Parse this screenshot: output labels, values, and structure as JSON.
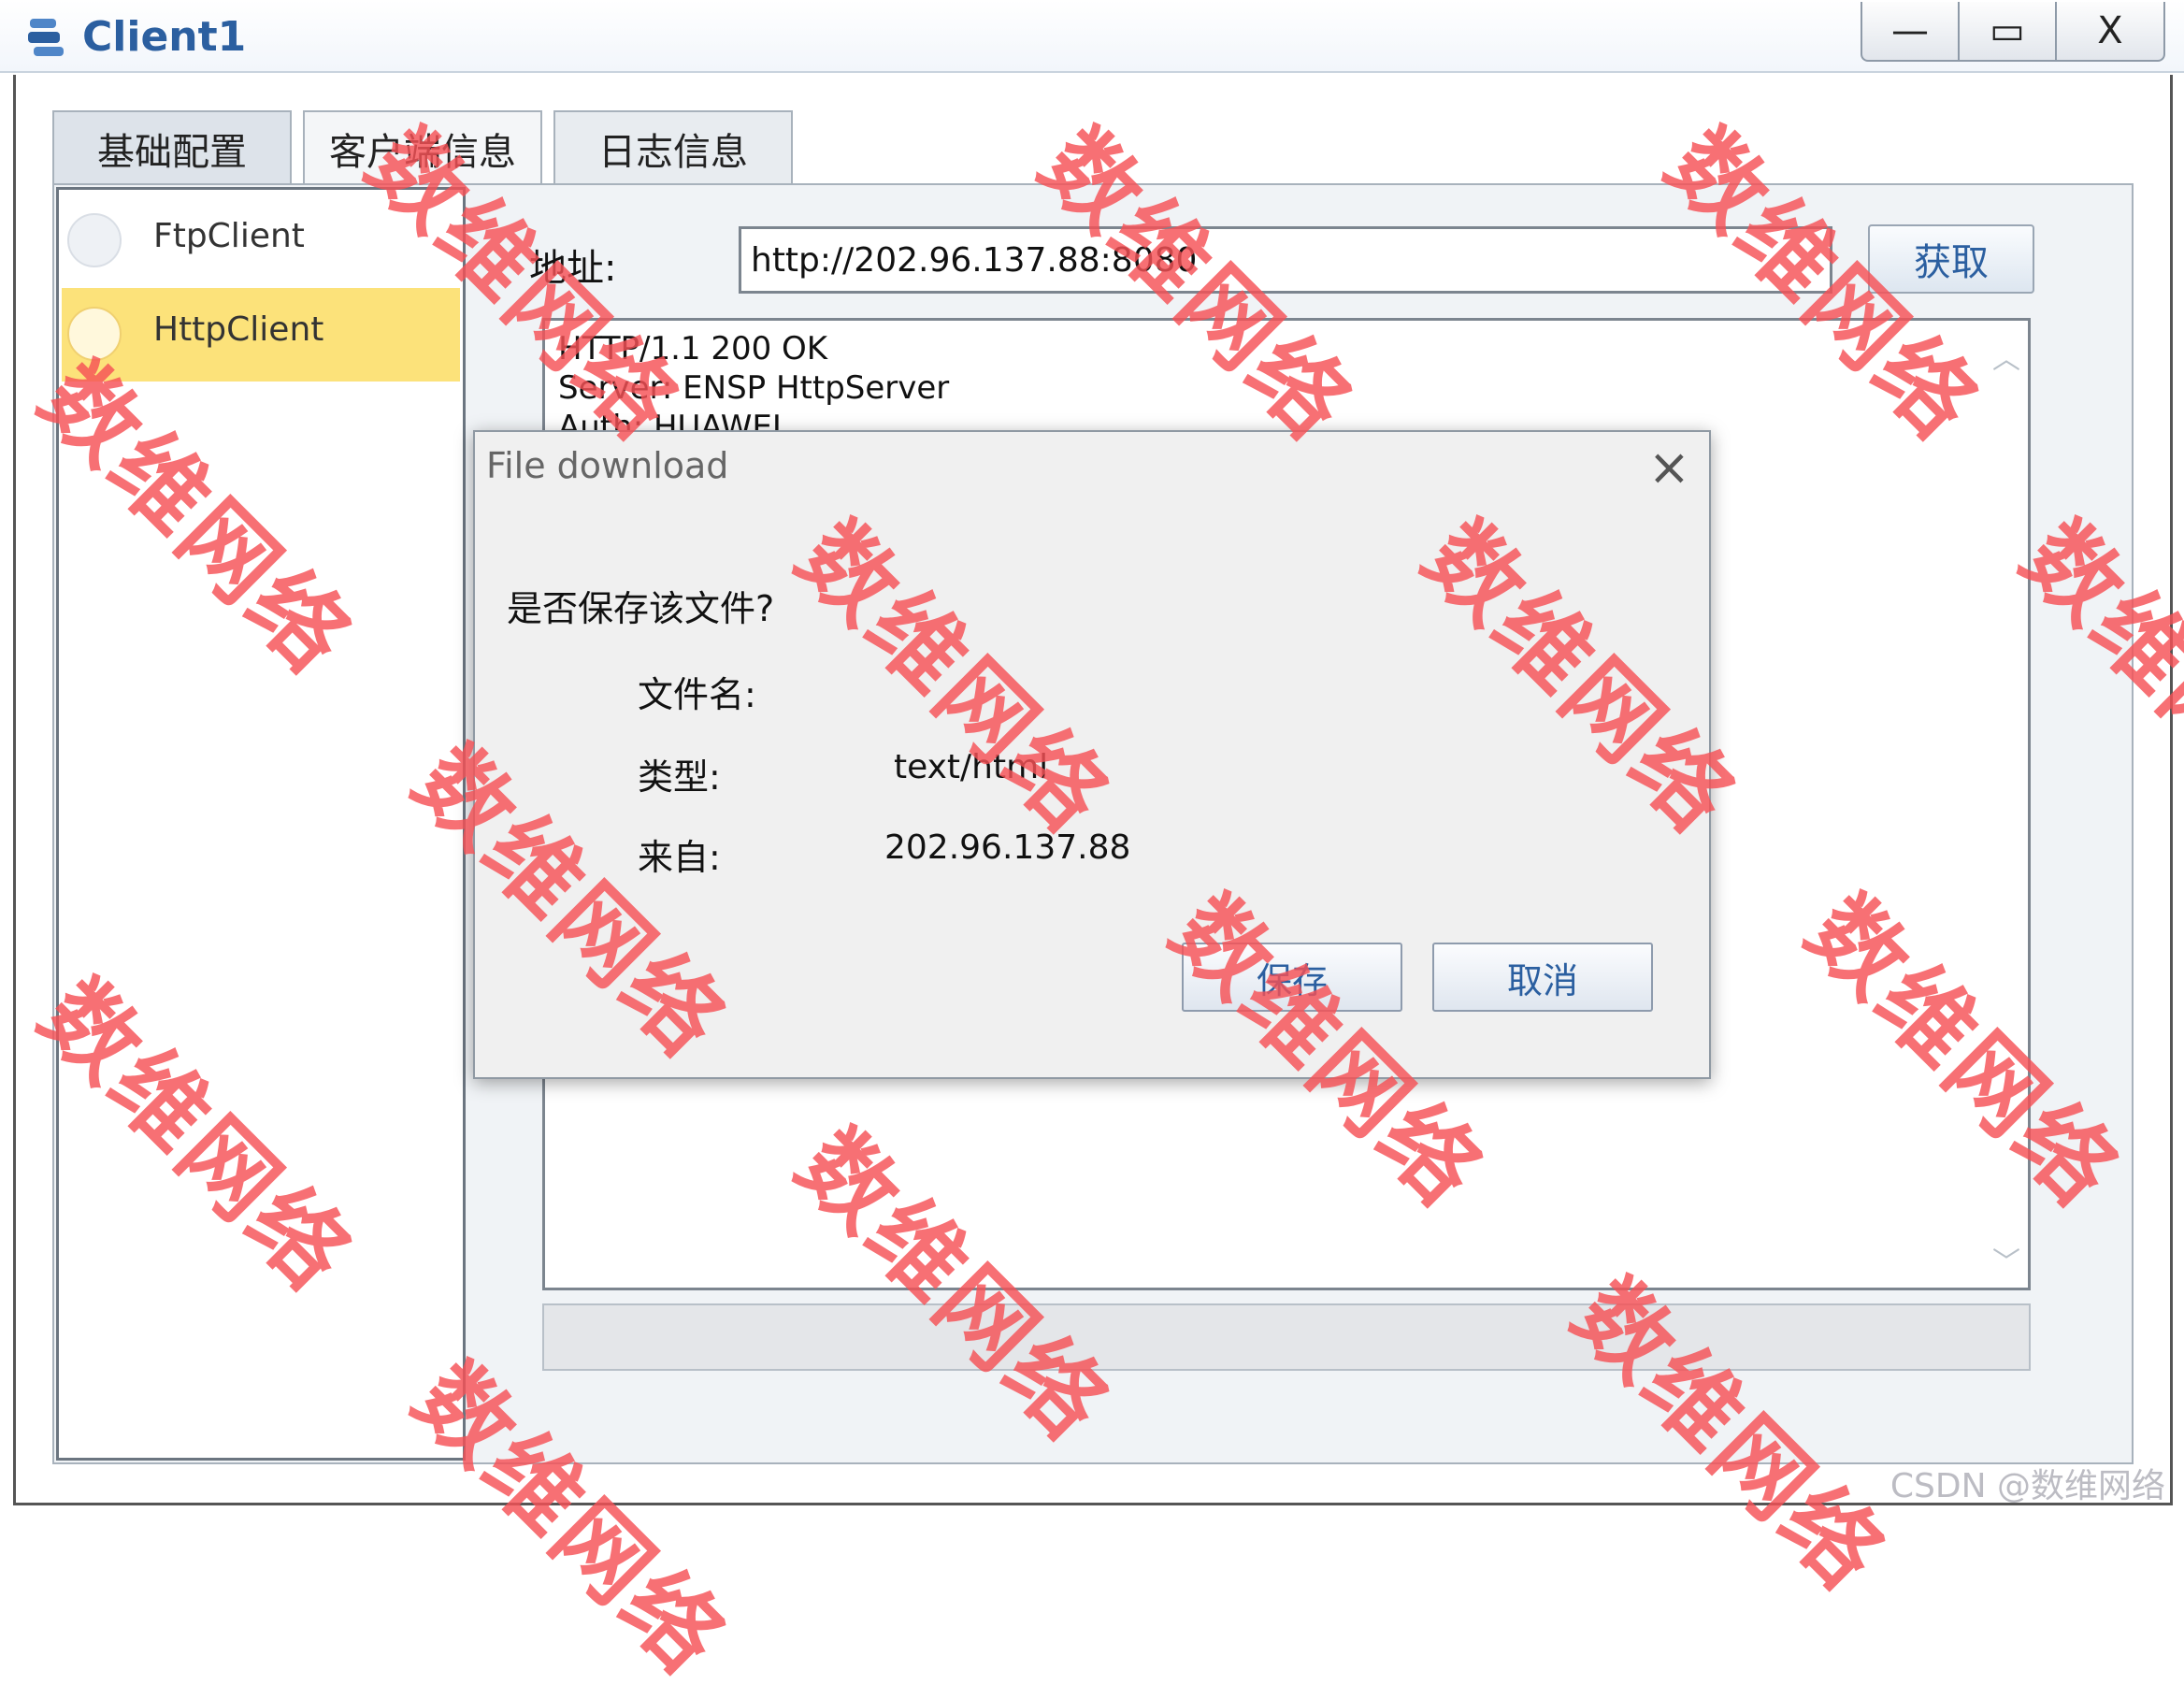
{
  "window": {
    "title": "Client1",
    "min_label": "—",
    "max_label": "▭",
    "close_label": "X"
  },
  "tabs": [
    {
      "label": "基础配置"
    },
    {
      "label": "客户端信息"
    },
    {
      "label": "日志信息"
    }
  ],
  "client_list": [
    {
      "label": "FtpClient",
      "selected": false
    },
    {
      "label": "HttpClient",
      "selected": true
    }
  ],
  "address": {
    "label": "地址:",
    "value": "http://202.96.137.88:8080",
    "fetch_label": "获取"
  },
  "response": {
    "lines": [
      "HTTP/1.1 200 OK",
      "Server: ENSP HttpServer",
      "Auth: HUAWEI"
    ]
  },
  "dialog": {
    "title": "File download",
    "question": "是否保存该文件?",
    "filename_label": "文件名:",
    "type_label": "类型:",
    "type_value": "text/html",
    "from_label": "来自:",
    "from_value": "202.96.137.88",
    "save_label": "保存",
    "cancel_label": "取消"
  },
  "watermark": {
    "text": "数维网络",
    "footer": "CSDN @数维网络"
  },
  "colors": {
    "accent": "#2b5fa0",
    "selected": "#fce27a",
    "watermark": "#f55055"
  }
}
